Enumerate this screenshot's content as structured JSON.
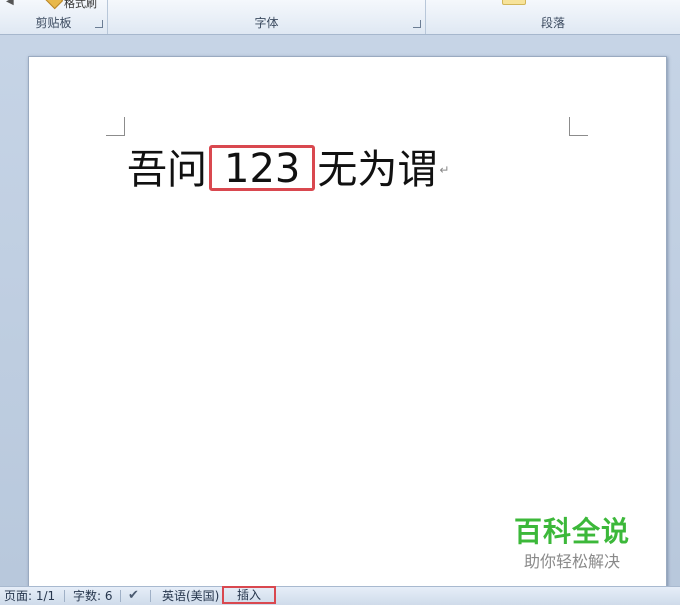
{
  "ribbon": {
    "groups": [
      {
        "label": "剪贴板",
        "partial_button": "格式刷"
      },
      {
        "label": "字体"
      },
      {
        "label": "段落"
      }
    ]
  },
  "document": {
    "text_before": "吾问",
    "highlighted_text": "123",
    "text_after": "无为谓",
    "paragraph_mark": "↵"
  },
  "watermark": {
    "title": "百科全说",
    "subtitle": "助你轻松解决"
  },
  "statusbar": {
    "page": "页面: 1/1",
    "word_count": "字数: 6",
    "language": "英语(美国)",
    "mode": "插入"
  },
  "colors": {
    "highlight_box": "#d9484f",
    "watermark_green": "#3cb83a"
  }
}
